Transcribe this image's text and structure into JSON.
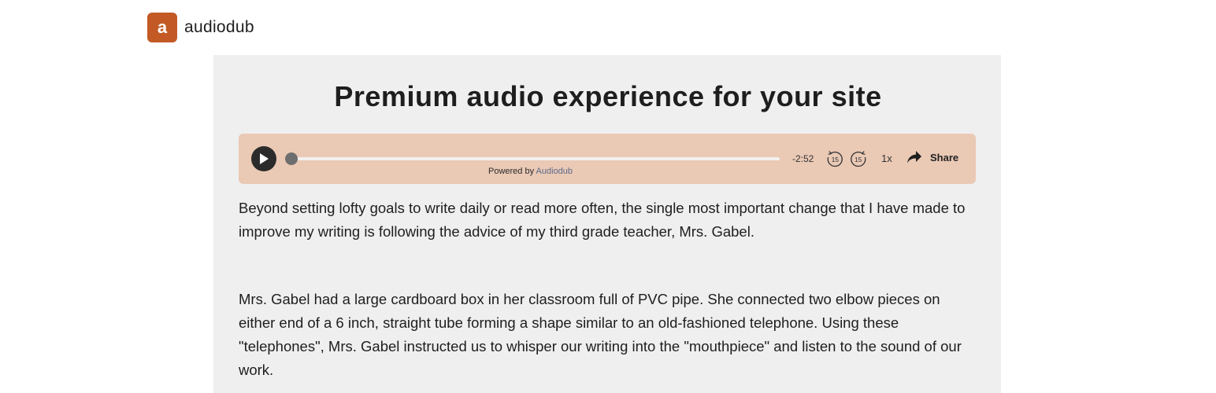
{
  "brand": {
    "logo_letter": "a",
    "name": "audiodub",
    "accent_color": "#c35a26"
  },
  "article": {
    "title": "Premium audio experience for your site",
    "paragraphs": [
      "Beyond setting lofty goals to write daily or read more often, the single most important change that I have made to improve my writing is following the advice of my third grade teacher, Mrs. Gabel.",
      "Mrs. Gabel had a large cardboard box in her classroom full of PVC pipe. She connected two elbow pieces on either end of a 6 inch, straight tube forming a shape similar to an old-fashioned telephone. Using these \"telephones\", Mrs. Gabel instructed us to whisper our writing into the \"mouthpiece\" and listen to the sound of our work."
    ]
  },
  "player": {
    "background_color": "#eac9b5",
    "progress": 0,
    "time_remaining": "-2:52",
    "rewind_label": "15",
    "forward_label": "15",
    "speed": "1x",
    "share_label": "Share",
    "powered_by_prefix": "Powered by",
    "powered_by_link": "Audiodub",
    "icons": {
      "play": "play-icon",
      "rewind": "rewind-15-icon",
      "forward": "forward-15-icon",
      "share": "share-arrow-icon"
    }
  }
}
